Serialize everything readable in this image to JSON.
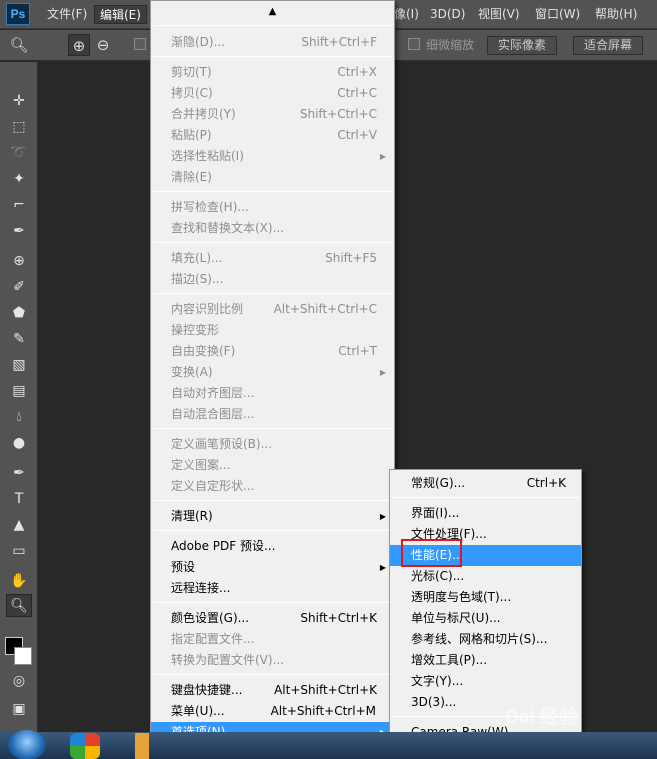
{
  "app": {
    "logo": "Ps"
  },
  "menubar": {
    "items": [
      {
        "label": "文件(F)"
      },
      {
        "label": "编辑(E)"
      },
      {
        "label": "图像(I)"
      },
      {
        "label": "3D(D)"
      },
      {
        "label": "视图(V)"
      },
      {
        "label": "窗口(W)"
      },
      {
        "label": "帮助(H)"
      }
    ],
    "partial_label": "像(I)"
  },
  "options_bar": {
    "fine_zoom_label": "细微缩放",
    "actual_pixels_label": "实际像素",
    "fit_screen_label": "适合屏幕"
  },
  "edit_menu": {
    "items": [
      {
        "label": "渐隐(D)...",
        "shortcut": "Shift+Ctrl+F",
        "enabled": false
      },
      {
        "label": "剪切(T)",
        "shortcut": "Ctrl+X",
        "enabled": false
      },
      {
        "label": "拷贝(C)",
        "shortcut": "Ctrl+C",
        "enabled": false
      },
      {
        "label": "合并拷贝(Y)",
        "shortcut": "Shift+Ctrl+C",
        "enabled": false
      },
      {
        "label": "粘贴(P)",
        "shortcut": "Ctrl+V",
        "enabled": false
      },
      {
        "label": "选择性粘贴(I)",
        "shortcut": "",
        "enabled": false,
        "submenu": true
      },
      {
        "label": "清除(E)",
        "shortcut": "",
        "enabled": false
      },
      {
        "label": "拼写检查(H)...",
        "shortcut": "",
        "enabled": false
      },
      {
        "label": "查找和替换文本(X)...",
        "shortcut": "",
        "enabled": false
      },
      {
        "label": "填充(L)...",
        "shortcut": "Shift+F5",
        "enabled": false
      },
      {
        "label": "描边(S)...",
        "shortcut": "",
        "enabled": false
      },
      {
        "label": "内容识别比例",
        "shortcut": "Alt+Shift+Ctrl+C",
        "enabled": false
      },
      {
        "label": "操控变形",
        "shortcut": "",
        "enabled": false
      },
      {
        "label": "自由变换(F)",
        "shortcut": "Ctrl+T",
        "enabled": false
      },
      {
        "label": "变换(A)",
        "shortcut": "",
        "enabled": false,
        "submenu": true
      },
      {
        "label": "自动对齐图层...",
        "shortcut": "",
        "enabled": false
      },
      {
        "label": "自动混合图层...",
        "shortcut": "",
        "enabled": false
      },
      {
        "label": "定义画笔预设(B)...",
        "shortcut": "",
        "enabled": false
      },
      {
        "label": "定义图案...",
        "shortcut": "",
        "enabled": false
      },
      {
        "label": "定义自定形状...",
        "shortcut": "",
        "enabled": false
      },
      {
        "label": "清理(R)",
        "shortcut": "",
        "enabled": true,
        "submenu": true
      },
      {
        "label": "Adobe PDF 预设...",
        "shortcut": "",
        "enabled": true
      },
      {
        "label": "预设",
        "shortcut": "",
        "enabled": true,
        "submenu": true
      },
      {
        "label": "远程连接...",
        "shortcut": "",
        "enabled": true
      },
      {
        "label": "颜色设置(G)...",
        "shortcut": "Shift+Ctrl+K",
        "enabled": true
      },
      {
        "label": "指定配置文件...",
        "shortcut": "",
        "enabled": false
      },
      {
        "label": "转换为配置文件(V)...",
        "shortcut": "",
        "enabled": false
      },
      {
        "label": "键盘快捷键...",
        "shortcut": "Alt+Shift+Ctrl+K",
        "enabled": true
      },
      {
        "label": "菜单(U)...",
        "shortcut": "Alt+Shift+Ctrl+M",
        "enabled": true
      },
      {
        "label": "首选项(N)",
        "shortcut": "",
        "enabled": true,
        "submenu": true,
        "highlighted": true
      }
    ]
  },
  "preferences_submenu": {
    "items": [
      {
        "label": "常规(G)...",
        "shortcut": "Ctrl+K"
      },
      {
        "label": "界面(I)...",
        "shortcut": ""
      },
      {
        "label": "文件处理(F)...",
        "shortcut": ""
      },
      {
        "label": "性能(E)...",
        "shortcut": "",
        "highlighted": true
      },
      {
        "label": "光标(C)...",
        "shortcut": ""
      },
      {
        "label": "透明度与色域(T)...",
        "shortcut": ""
      },
      {
        "label": "单位与标尺(U)...",
        "shortcut": ""
      },
      {
        "label": "参考线、网格和切片(S)...",
        "shortcut": ""
      },
      {
        "label": "增效工具(P)...",
        "shortcut": ""
      },
      {
        "label": "文字(Y)...",
        "shortcut": ""
      },
      {
        "label": "3D(3)...",
        "shortcut": ""
      },
      {
        "label": "Camera Raw(W)...",
        "shortcut": ""
      }
    ]
  },
  "watermark": {
    "text": "Bai 经验"
  },
  "colors": {
    "highlight": "#3399ff",
    "annotation": "#e0161b",
    "menu_bg": "#f0f0f0",
    "app_bg": "#535353"
  }
}
